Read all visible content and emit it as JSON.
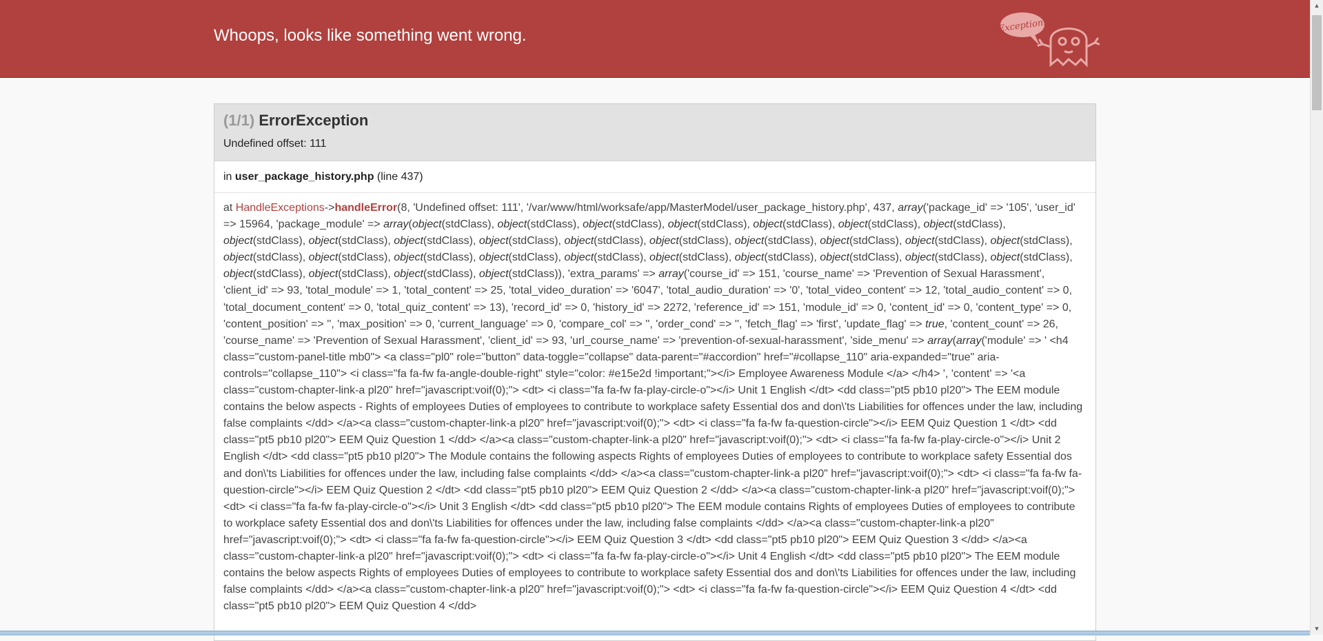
{
  "header": {
    "title": "Whoops, looks like something went wrong.",
    "badge_text": "Exception!"
  },
  "exception": {
    "count": "(1/1)",
    "name": "ErrorException",
    "message": "Undefined offset: 111",
    "location_prefix": "in",
    "file": "user_package_history.php",
    "line": "(line 437)"
  },
  "trace": {
    "at": "at",
    "class_name": "HandleExceptions",
    "arrow": "->",
    "function_name": "handleError",
    "open_paren": "(",
    "args_1": "8, 'Undefined offset: 111', '/var/www/html/worksafe/app/MasterModel/user_package_history.php', 437, ",
    "array_kw": "array",
    "args_2": "('package_id' => '105', 'user_id' => 15964, 'package_module' => ",
    "args_3": "(",
    "object_kw": "object",
    "stdclass": "(stdClass)",
    "sep": ", ",
    "object_count": 31,
    "args_4": "), 'extra_params' => ",
    "args_5": "('course_id' => 151, 'course_name' => 'Prevention of Sexual Harassment', 'client_id' => 93, 'total_module' => 1, 'total_content' => 25, 'total_video_duration' => '6047', 'total_audio_duration' => '0', 'total_video_content' => 12, 'total_audio_content' => 0, 'total_document_content' => 0, 'total_quiz_content' => 13), 'record_id' => 0, 'history_id' => 2272, 'reference_id' => 151, 'module_id' => 0, 'content_id' => 0, 'content_type' => 0, 'content_position' => '', 'max_position' => 0, 'current_language' => 0, 'compare_col' => '', 'order_cond' => '', 'fetch_flag' => 'first', 'update_flag' => ",
    "true_kw": "true",
    "args_6": ", 'content_count' => 26, 'course_name' => 'Prevention of Sexual Harassment', 'client_id' => 93, 'url_course_name' => 'prevention-of-sexual-harassment', 'side_menu' => ",
    "args_7": "(",
    "args_8": "('module' => ' <h4 class=\"custom-panel-title mb0\"> <a class=\"pl0\" role=\"button\" data-toggle=\"collapse\" data-parent=\"#accordion\" href=\"#collapse_110\" aria-expanded=\"true\" aria-controls=\"collapse_110\"> <i class=\"fa fa-fw fa-angle-double-right\" style=\"color: #e15e2d !important;\"></i> Employee Awareness Module </a> </h4> ', 'content' => '<a class=\"custom-chapter-link-a pl20\" href=\"javascript:voif(0);\"> <dt> <i class=\"fa fa-fw fa-play-circle-o\"></i> Unit 1 English </dt> <dd class=\"pt5 pb10 pl20\"> The EEM module contains the below aspects - Rights of employees Duties of employees to contribute to workplace safety Essential dos and don\\'ts Liabilities for offences under the law, including false complaints </dd> </a><a class=\"custom-chapter-link-a pl20\" href=\"javascript:voif(0);\"> <dt> <i class=\"fa fa-fw fa-question-circle\"></i> EEM Quiz Question 1 </dt> <dd class=\"pt5 pb10 pl20\"> EEM Quiz Question 1 </dd> </a><a class=\"custom-chapter-link-a pl20\" href=\"javascript:voif(0);\"> <dt> <i class=\"fa fa-fw fa-play-circle-o\"></i> Unit 2 English </dt> <dd class=\"pt5 pb10 pl20\"> The Module contains the following aspects Rights of employees Duties of employees to contribute to workplace safety Essential dos and don\\'ts Liabilities for offences under the law, including false complaints </dd> </a><a class=\"custom-chapter-link-a pl20\" href=\"javascript:voif(0);\"> <dt> <i class=\"fa fa-fw fa-question-circle\"></i> EEM Quiz Question 2 </dt> <dd class=\"pt5 pb10 pl20\"> EEM Quiz Question 2 </dd> </a><a class=\"custom-chapter-link-a pl20\" href=\"javascript:voif(0);\"> <dt> <i class=\"fa fa-fw fa-play-circle-o\"></i> Unit 3 English </dt> <dd class=\"pt5 pb10 pl20\"> The EEM module contains Rights of employees Duties of employees to contribute to workplace safety Essential dos and don\\'ts Liabilities for offences under the law, including false complaints </dd> </a><a class=\"custom-chapter-link-a pl20\" href=\"javascript:voif(0);\"> <dt> <i class=\"fa fa-fw fa-question-circle\"></i> EEM Quiz Question 3 </dt> <dd class=\"pt5 pb10 pl20\"> EEM Quiz Question 3 </dd> </a><a class=\"custom-chapter-link-a pl20\" href=\"javascript:voif(0);\"> <dt> <i class=\"fa fa-fw fa-play-circle-o\"></i> Unit 4 English </dt> <dd class=\"pt5 pb10 pl20\"> The EEM module contains the below aspects Rights of employees Duties of employees to contribute to workplace safety Essential dos and don\\'ts Liabilities for offences under the law, including false complaints </dd> </a><a class=\"custom-chapter-link-a pl20\" href=\"javascript:voif(0);\"> <dt> <i class=\"fa fa-fw fa-question-circle\"></i> EEM Quiz Question 4 </dt> <dd class=\"pt5 pb10 pl20\"> EEM Quiz Question 4 </dd>"
  },
  "colors": {
    "header_bg": "#b0413e",
    "panel_head_bg": "#e2e2e2",
    "accent": "#b0413e",
    "ghost": "#e8a9a7"
  },
  "icons": {
    "mascot": "ghost-icon",
    "scroll_up": "chevron-up-icon",
    "scroll_down": "chevron-down-icon"
  }
}
